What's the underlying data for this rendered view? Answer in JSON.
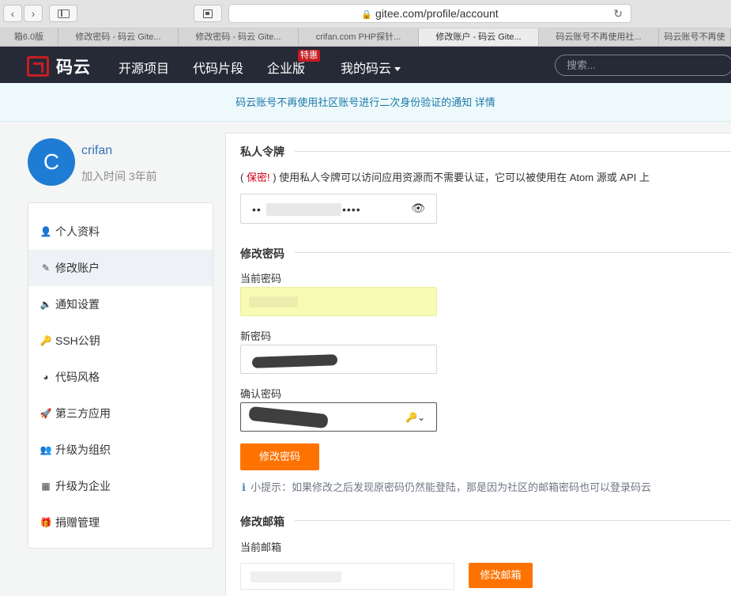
{
  "browser": {
    "url": "gitee.com/profile/account",
    "tabs": [
      {
        "label": "箱6.0版",
        "active": false
      },
      {
        "label": "修改密码 - 码云 Gite...",
        "active": false
      },
      {
        "label": "修改密码 - 码云 Gite...",
        "active": false
      },
      {
        "label": "crifan.com PHP探针...",
        "active": false
      },
      {
        "label": "修改账户 - 码云 Gite...",
        "active": true
      },
      {
        "label": "码云账号不再使用社...",
        "active": false
      },
      {
        "label": "码云账号不再使",
        "active": false
      }
    ]
  },
  "header": {
    "logo_text": "码云",
    "nav": [
      {
        "label": "开源项目"
      },
      {
        "label": "代码片段"
      },
      {
        "label": "企业版"
      },
      {
        "label": "我的码云"
      }
    ],
    "hot_badge": "特惠",
    "search_placeholder": "搜索..."
  },
  "notice": {
    "text": "码云账号不再使用社区账号进行二次身份验证的通知 详情"
  },
  "profile": {
    "avatar_letter": "C",
    "username": "crifan",
    "join_time": "加入时间 3年前"
  },
  "menu": {
    "items": [
      {
        "label": "个人资料",
        "icon": "user-icon",
        "glyph": "👤"
      },
      {
        "label": "修改账户",
        "icon": "pencil-icon",
        "glyph": "✎"
      },
      {
        "label": "通知设置",
        "icon": "volume-icon",
        "glyph": "🔈"
      },
      {
        "label": "SSH公钥",
        "icon": "key-icon",
        "glyph": "🔑"
      },
      {
        "label": "代码风格",
        "icon": "dashboard-icon",
        "glyph": "◕"
      },
      {
        "label": "第三方应用",
        "icon": "rocket-icon",
        "glyph": "🚀"
      },
      {
        "label": "升级为组织",
        "icon": "users-icon",
        "glyph": "👥"
      },
      {
        "label": "升级为企业",
        "icon": "building-icon",
        "glyph": "▦"
      },
      {
        "label": "捐赠管理",
        "icon": "gift-icon",
        "glyph": "🎁"
      }
    ]
  },
  "token": {
    "title": "私人令牌",
    "note_open": "( ",
    "note_secret": "保密!",
    "note_rest": " ) 使用私人令牌可以访问应用资源而不需要认证，它可以被使用在 Atom 源或 API 上",
    "masked_prefix": "••",
    "masked_suffix": "••••"
  },
  "password": {
    "title": "修改密码",
    "current_label": "当前密码",
    "new_label": "新密码",
    "confirm_label": "确认密码",
    "submit_label": "修改密码",
    "tip": "小提示：如果修改之后发现原密码仍然能登陆，那是因为社区的邮箱密码也可以登录码云"
  },
  "email": {
    "title": "修改邮箱",
    "current_label": "当前邮箱",
    "submit_label": "修改邮箱"
  },
  "colors": {
    "header_bg": "#252a36",
    "brand_red": "#c71d23",
    "orange": "#fe7300",
    "link_blue": "#3773b8"
  }
}
